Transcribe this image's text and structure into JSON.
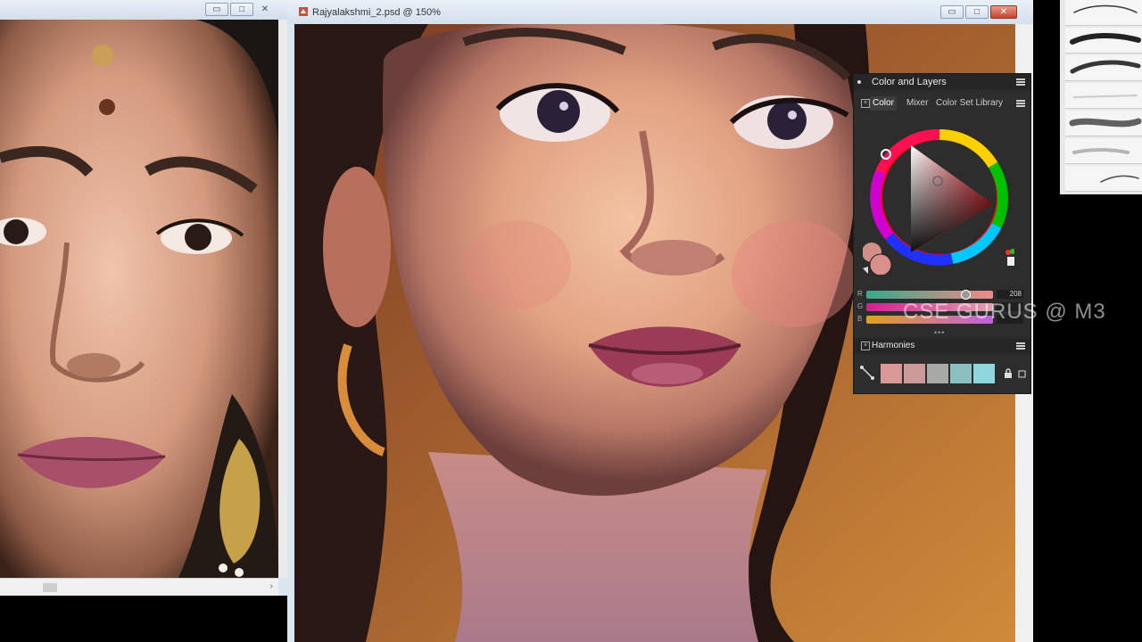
{
  "reference_window": {
    "minimize_symbol": "▭",
    "maximize_symbol": "□",
    "close_symbol": "✕",
    "scroll_right_symbol": "›",
    "image_alt": "reference photo of a woman"
  },
  "main_window": {
    "document_title": "Rajyalakshmi_2.psd @ 150%",
    "minimize_symbol": "▭",
    "maximize_symbol": "□",
    "close_symbol": "✕"
  },
  "color_panel": {
    "title": "Color and Layers",
    "tabs": [
      "Color",
      "Mixer",
      "Color Set Library"
    ],
    "active_tab": "Color",
    "sliders": [
      {
        "label": "R",
        "value": "208"
      },
      {
        "label": "G",
        "value": ""
      },
      {
        "label": "B",
        "value": ""
      }
    ],
    "harmonies_title": "Harmonies",
    "harmony_swatches": [
      "#d99a96",
      "#cc9a98",
      "#a7a9a6",
      "#8cbfc0",
      "#8fd6dd"
    ],
    "main_color": "#d9908a"
  },
  "brush_panel": {
    "brush_count": 7
  },
  "watermark": "CSE GURUS @ M3",
  "colors": {
    "titlebar": "#d5e0ed",
    "close_button": "#c5422c",
    "panel_bg": "#2d2d2d"
  }
}
